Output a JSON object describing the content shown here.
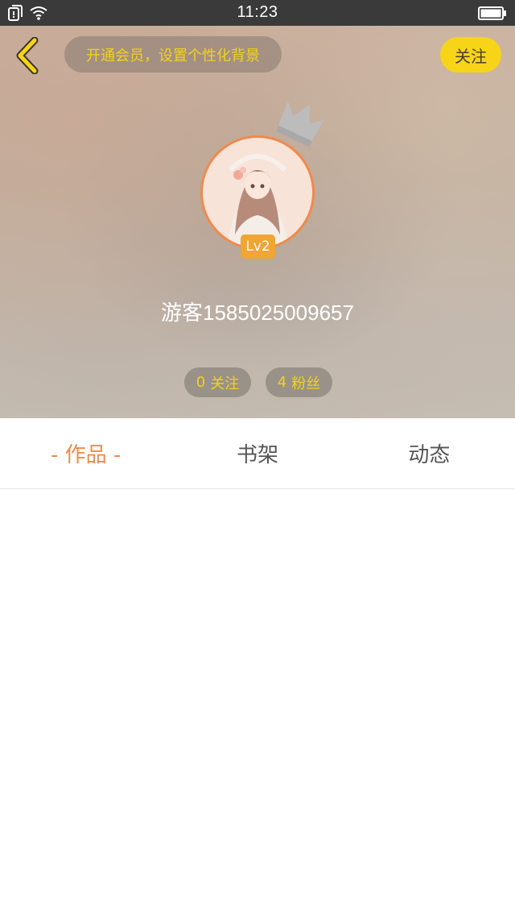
{
  "status_bar": {
    "time": "11:23",
    "icons": [
      "sim-card-icon",
      "wifi-icon",
      "battery-icon"
    ]
  },
  "header": {
    "vip_prompt": "开通会员，设置个性化背景",
    "follow_label": "关注",
    "username": "游客1585025009657",
    "level": "Lv2",
    "following_count": "0",
    "following_label": "关注",
    "fans_count": "4",
    "fans_label": "粉丝"
  },
  "tabs": [
    {
      "label": "- 作品 -",
      "active": true
    },
    {
      "label": "书架",
      "active": false
    },
    {
      "label": "动态",
      "active": false
    }
  ],
  "colors": {
    "accent_yellow": "#f7d417",
    "accent_orange": "#ef8a4c",
    "level_badge": "#f0a534",
    "status_bar": "#3a3a3a"
  }
}
